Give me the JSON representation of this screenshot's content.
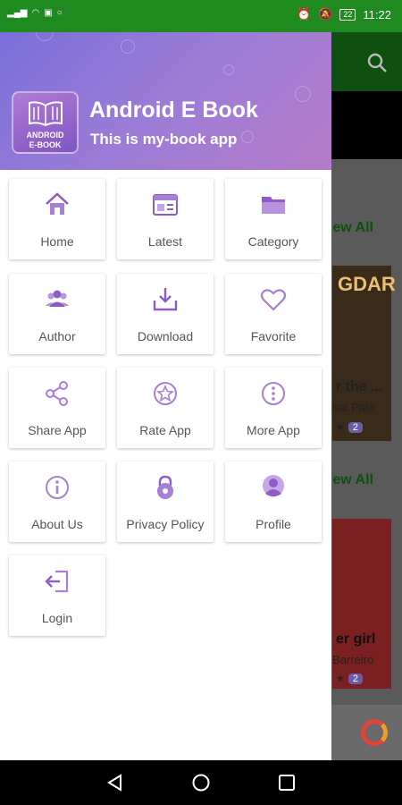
{
  "status_bar": {
    "battery": "22",
    "time": "11:22"
  },
  "background": {
    "view_all_1": "ew All",
    "view_all_2": "ew All",
    "book1_cover_text": "GDAR",
    "book1_title": "r the ...",
    "book1_author": "hai Pate",
    "book1_rating": "2",
    "book2_title": "er girl",
    "book2_author": "Barreiro",
    "book2_rating": "2"
  },
  "drawer": {
    "logo_line1": "ANDROID",
    "logo_line2": "E-BOOK",
    "title": "Android E Book",
    "subtitle": "This is my-book app",
    "items": [
      {
        "label": "Home",
        "icon": "home-icon"
      },
      {
        "label": "Latest",
        "icon": "latest-icon"
      },
      {
        "label": "Category",
        "icon": "folder-icon"
      },
      {
        "label": "Author",
        "icon": "group-icon"
      },
      {
        "label": "Download",
        "icon": "download-icon"
      },
      {
        "label": "Favorite",
        "icon": "heart-icon"
      },
      {
        "label": "Share App",
        "icon": "share-icon"
      },
      {
        "label": "Rate App",
        "icon": "star-badge-icon"
      },
      {
        "label": "More App",
        "icon": "more-vertical-icon"
      },
      {
        "label": "About Us",
        "icon": "info-icon"
      },
      {
        "label": "Privacy Policy",
        "icon": "lock-icon"
      },
      {
        "label": "Profile",
        "icon": "person-icon"
      },
      {
        "label": "Login",
        "icon": "login-icon"
      }
    ]
  },
  "colors": {
    "accent": "#8e5cc8",
    "status_bar": "#1f8a1f",
    "header_start": "#7a6fd9",
    "header_end": "#b57cc8"
  }
}
